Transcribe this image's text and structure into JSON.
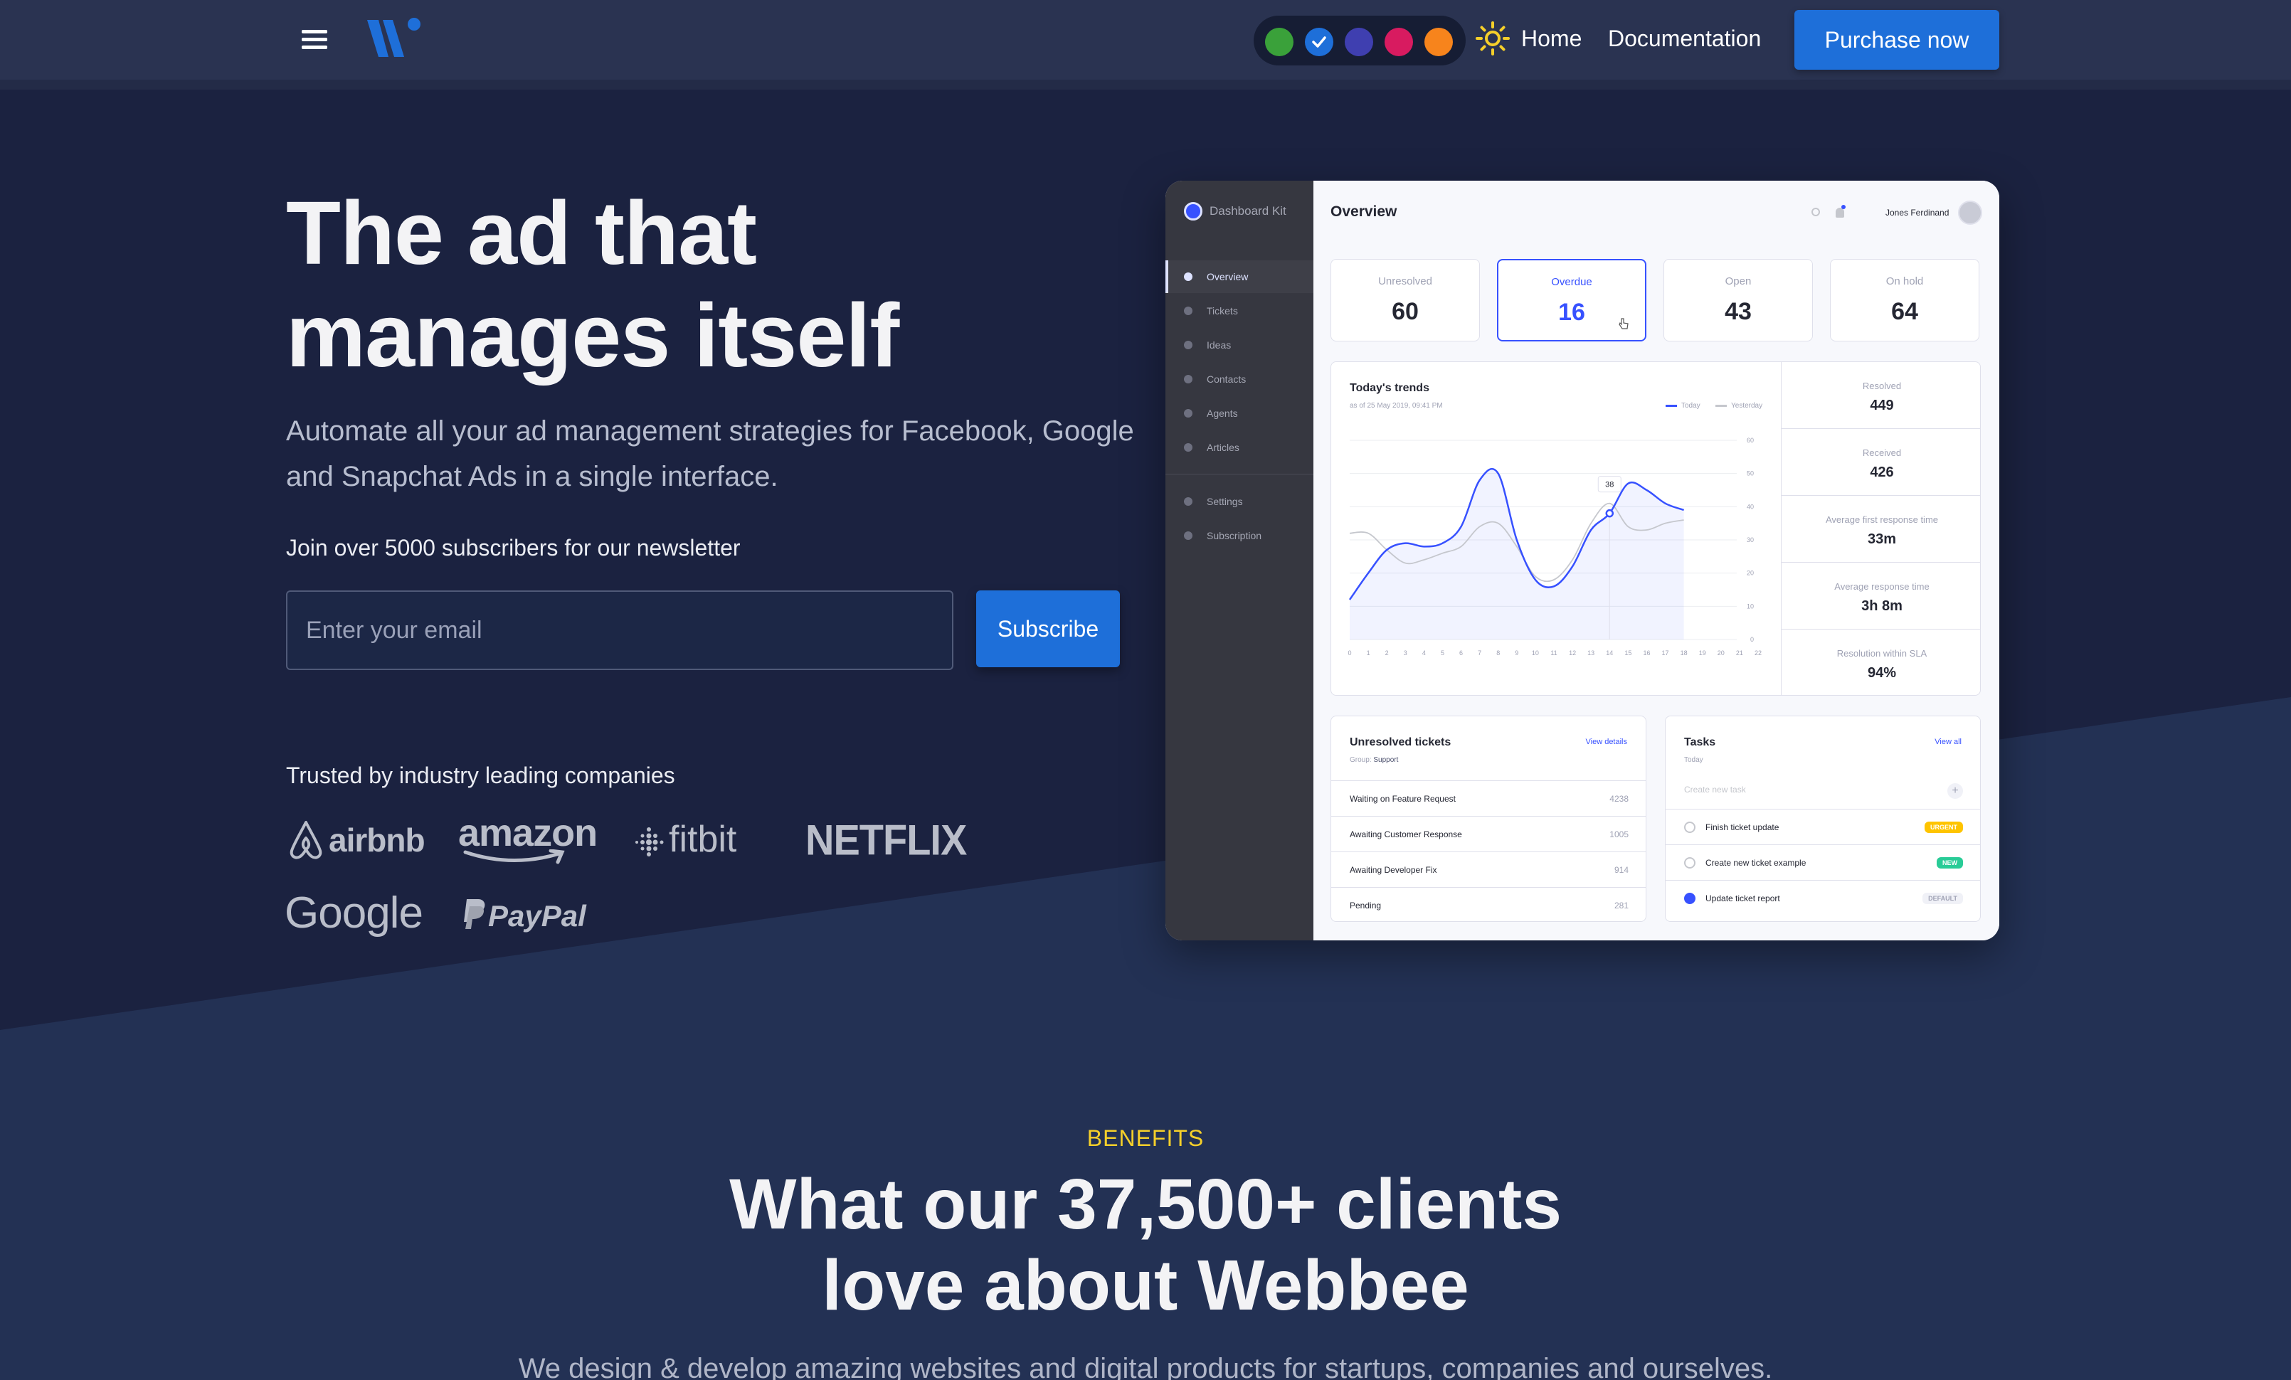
{
  "nav": {
    "links": [
      "Home",
      "Documentation"
    ],
    "purchase_label": "Purchase now",
    "theme_colors": [
      "#3aa13a",
      "#1e6fd9",
      "#3f3fb0",
      "#d81b60",
      "#f7841c"
    ],
    "selected_theme": "#1e6fd9",
    "icons": [
      "menu-icon",
      "logo-icon",
      "check-icon",
      "sun-icon"
    ]
  },
  "hero": {
    "headline_line1": "The ad that",
    "headline_line2": "manages itself",
    "subhead": "Automate all your ad management strategies for Facebook, Google and Snapchat Ads in a single interface.",
    "newsletter_label": "Join over 5000 subscribers for our newsletter",
    "email_placeholder": "Enter your email",
    "subscribe_label": "Subscribe",
    "trusted_label": "Trusted by industry leading companies",
    "brands": [
      "airbnb",
      "amazon",
      "fitbit",
      "NETFLIX",
      "Google",
      "PayPal"
    ]
  },
  "dashboard": {
    "brand": "Dashboard Kit",
    "sidebar": [
      "Overview",
      "Tickets",
      "Ideas",
      "Contacts",
      "Agents",
      "Articles"
    ],
    "sidebar_bottom": [
      "Settings",
      "Subscription"
    ],
    "title": "Overview",
    "user": "Jones Ferdinand",
    "stats": [
      {
        "label": "Unresolved",
        "value": "60"
      },
      {
        "label": "Overdue",
        "value": "16"
      },
      {
        "label": "Open",
        "value": "43"
      },
      {
        "label": "On hold",
        "value": "64"
      }
    ],
    "trends": {
      "title": "Today's trends",
      "date": "as of 25 May 2019, 09:41 PM",
      "legend_today": "Today",
      "legend_yesterday": "Yesterday",
      "tooltip": "38"
    },
    "trend_stats": [
      {
        "label": "Resolved",
        "value": "449"
      },
      {
        "label": "Received",
        "value": "426"
      },
      {
        "label": "Average first response time",
        "value": "33m"
      },
      {
        "label": "Average response time",
        "value": "3h 8m"
      },
      {
        "label": "Resolution within SLA",
        "value": "94%"
      }
    ],
    "unresolved": {
      "title": "Unresolved tickets",
      "link": "View details",
      "group_label": "Group:",
      "group_value": "Support",
      "rows": [
        {
          "name": "Waiting on Feature Request",
          "count": "4238"
        },
        {
          "name": "Awaiting Customer Response",
          "count": "1005"
        },
        {
          "name": "Awaiting Developer Fix",
          "count": "914"
        },
        {
          "name": "Pending",
          "count": "281"
        }
      ]
    },
    "tasks": {
      "title": "Tasks",
      "link": "View all",
      "sub": "Today",
      "input_placeholder": "Create new task",
      "items": [
        {
          "name": "Finish ticket update",
          "badge": "URGENT",
          "badge_color": "#fec400",
          "done": false
        },
        {
          "name": "Create new ticket example",
          "badge": "NEW",
          "badge_color": "#29cc97",
          "done": false
        },
        {
          "name": "Update ticket report",
          "badge": "DEFAULT",
          "badge_color": "#f0f1f7",
          "done": true
        }
      ]
    }
  },
  "chart_data": {
    "type": "line",
    "x": [
      0,
      1,
      2,
      3,
      4,
      5,
      6,
      7,
      8,
      9,
      10,
      11,
      12,
      13,
      14,
      15,
      16,
      17,
      18,
      19,
      20,
      21,
      22
    ],
    "ylim": [
      0,
      60
    ],
    "yticks": [
      0,
      10,
      20,
      30,
      40,
      50,
      60
    ],
    "series": [
      {
        "name": "Today",
        "color": "#3751ff",
        "values": [
          12,
          20,
          27,
          29,
          28,
          29,
          34,
          48,
          50,
          30,
          18,
          16,
          22,
          33,
          38,
          47,
          45,
          41,
          39
        ]
      },
      {
        "name": "Yesterday",
        "color": "#c5c7cd",
        "values": [
          32,
          32,
          27,
          23,
          24,
          26,
          28,
          34,
          35,
          28,
          19,
          18,
          24,
          35,
          41,
          34,
          33,
          35,
          36
        ]
      }
    ],
    "grid": true,
    "legend": "top-right"
  },
  "benefits": {
    "tag": "BENEFITS",
    "heading_line1": "What our 37,500+ clients",
    "heading_line2": "love about Webbee",
    "sub": "We design & develop amazing websites and digital products for startups, companies and ourselves."
  }
}
